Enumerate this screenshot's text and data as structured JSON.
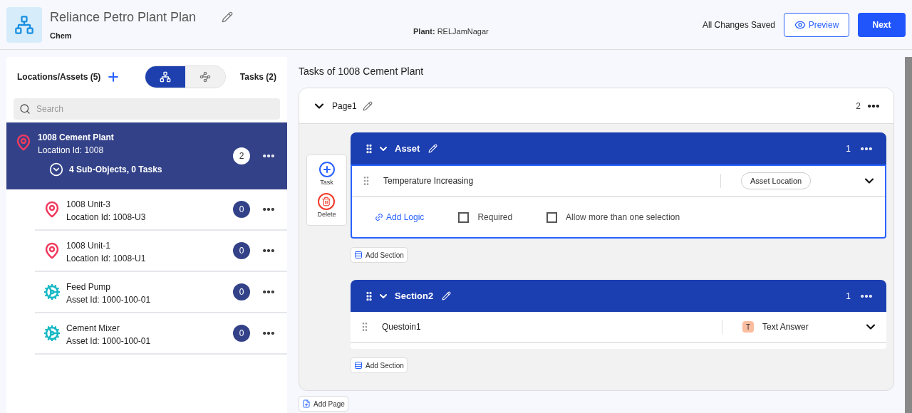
{
  "header": {
    "title": "Reliance Petro Plant Plan",
    "subtitle": "Chem",
    "plant_label": "Plant:",
    "plant": "RELJamNagar",
    "save_status": "All Changes Saved",
    "preview": "Preview",
    "next": "Next"
  },
  "left": {
    "title": "Locations/Assets (5)",
    "views": [
      {
        "kind": "tree",
        "selected": true
      },
      {
        "kind": "flow",
        "selected": false
      }
    ],
    "tasks": "Tasks (2)",
    "search": {
      "placeholder": "Search"
    },
    "items": [
      {
        "kind": "location",
        "name": "1008 Cement Plant",
        "id": "Location Id: 1008",
        "count": "2",
        "selected": true,
        "summary": "4 Sub-Objects, 0 Tasks"
      },
      {
        "kind": "location",
        "name": "1008 Unit-3",
        "id": "Location Id: 1008-U3",
        "count": "0",
        "selected": false
      },
      {
        "kind": "location",
        "name": "1008 Unit-1",
        "id": "Location Id: 1008-U1",
        "count": "0",
        "selected": false
      },
      {
        "kind": "asset",
        "name": "Feed Pump",
        "id": "Asset Id: 1000-100-01",
        "count": "0",
        "selected": false
      },
      {
        "kind": "asset",
        "name": "Cement Mixer",
        "id": "Asset Id: 1000-100-01",
        "count": "0",
        "selected": false
      }
    ]
  },
  "right": {
    "title": "Tasks of 1008 Cement Plant",
    "page": {
      "name": "Page1",
      "count": "2",
      "expanded": true
    },
    "tools": [
      "Task",
      "Delete"
    ],
    "sections": [
      {
        "name": "Asset",
        "count": "1",
        "add_section": "Add Section",
        "questions": [
          {
            "text": "Temperature Increasing",
            "response": {
              "kind": "chip",
              "label": "Asset Location"
            },
            "expanded": true,
            "add_logic": "Add Logic",
            "options": [
              {
                "label": "Required",
                "checked": false
              },
              {
                "label": "Allow more than one selection",
                "checked": false
              }
            ]
          }
        ]
      },
      {
        "name": "Section2",
        "count": "1",
        "add_section": "Add Section",
        "questions": [
          {
            "text": "Questoin1",
            "response": {
              "kind": "typed",
              "badge": "T",
              "label": "Text Answer"
            },
            "expanded": false
          }
        ]
      }
    ],
    "add_page": "Add Page"
  }
}
